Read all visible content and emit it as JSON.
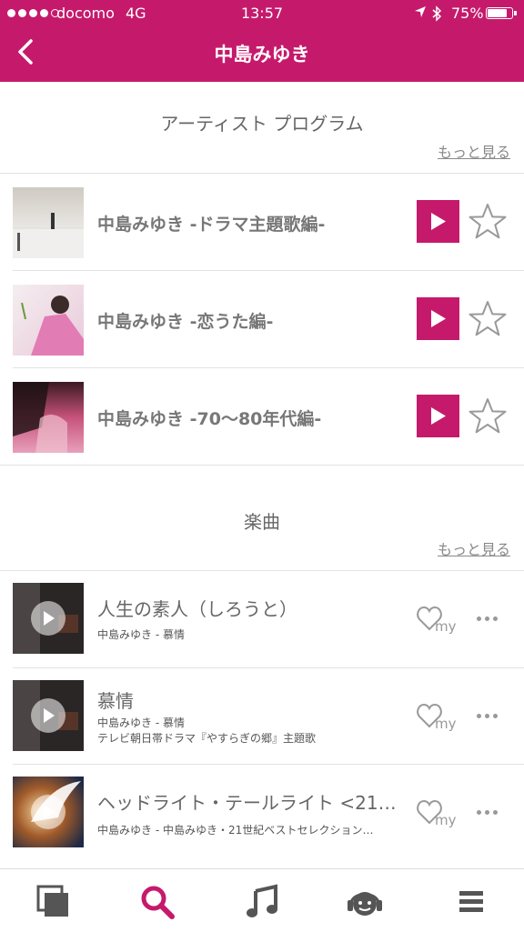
{
  "status_bar": {
    "carrier": "docomo",
    "network": "4G",
    "time": "13:57",
    "battery": "75%"
  },
  "nav": {
    "title": "中島みゆき"
  },
  "programs": {
    "heading": "アーティスト プログラム",
    "more": "もっと見る",
    "items": [
      {
        "title": "中島みゆき -ドラマ主題歌編-"
      },
      {
        "title": "中島みゆき -恋うた編-"
      },
      {
        "title": "中島みゆき -70～80年代編-"
      }
    ]
  },
  "songs": {
    "heading": "楽曲",
    "more": "もっと見る",
    "items": [
      {
        "title": "人生の素人（しろうと）",
        "subtitle": "中島みゆき - 慕情",
        "note": ""
      },
      {
        "title": "慕情",
        "subtitle": "中島みゆき - 慕情",
        "note": "テレビ朝日帯ドラマ『やすらぎの郷』主題歌"
      },
      {
        "title": "ヘッドライト・テールライト <21…",
        "subtitle": "中島みゆき - 中島みゆき・21世紀ベストセレクション…",
        "note": ""
      }
    ]
  },
  "tabbar": {
    "tabs": [
      {
        "icon": "library-icon",
        "active": false
      },
      {
        "icon": "search-icon",
        "active": true
      },
      {
        "icon": "music-note-icon",
        "active": false
      },
      {
        "icon": "headphones-icon",
        "active": false
      },
      {
        "icon": "menu-icon",
        "active": false
      }
    ]
  },
  "colors": {
    "accent": "#c51a6c",
    "inactive_icon": "#555555"
  }
}
